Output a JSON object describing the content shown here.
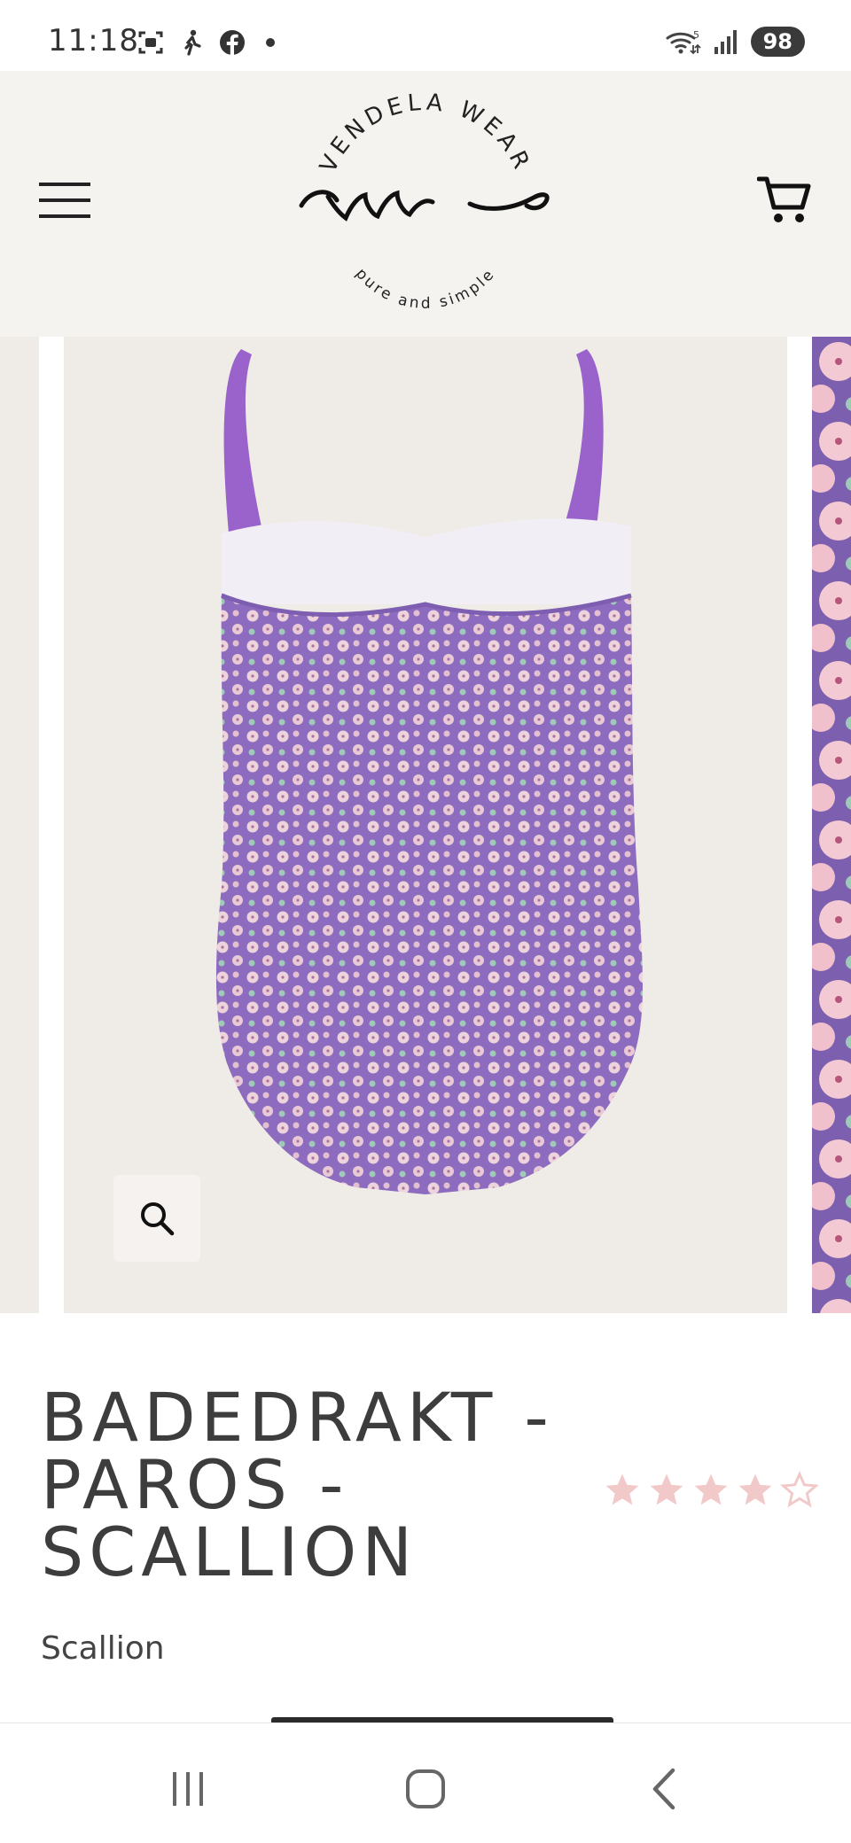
{
  "status_bar": {
    "time": "11:18",
    "battery": "98",
    "network_badge": "5"
  },
  "header": {
    "logo": {
      "brand": "VENDELA WEAR",
      "monogram": "vw",
      "tagline": "pure and simple"
    },
    "menu_icon": "hamburger-icon",
    "cart_icon": "cart-icon"
  },
  "gallery": {
    "zoom_icon": "search-icon",
    "main_colors": {
      "background": "#efebe6",
      "fabric": "#8d6cc0",
      "flowers": "#ecd3dc",
      "strap": "#9a63cc",
      "lining": "#f2eef6"
    }
  },
  "product": {
    "title": "BADEDRAKT - PAROS - SCALLION",
    "rating": 4,
    "rating_max": 5,
    "variant": "Scallion",
    "star_color": "#f2c9c9"
  },
  "nav_bar": {
    "recents_icon": "recents-icon",
    "home_icon": "home-icon",
    "back_icon": "back-icon"
  }
}
